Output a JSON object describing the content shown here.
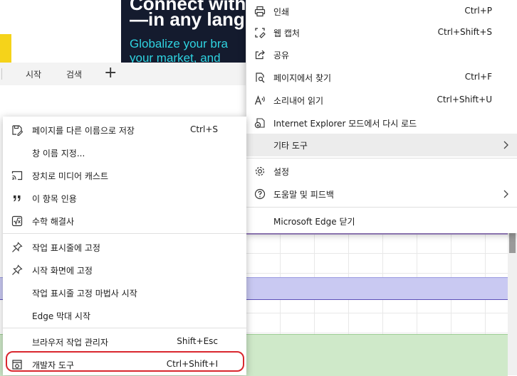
{
  "banner": {
    "line1": "Connect with",
    "line2": "—in any langu",
    "line3": "Globalize your bra",
    "line4": "your market, and"
  },
  "tabs": [
    {
      "label": "시작"
    },
    {
      "label": "검색"
    }
  ],
  "new_tab_glyph": "+",
  "main_menu": {
    "items": [
      {
        "label": "인쇄",
        "shortcut": "Ctrl+P",
        "icon": "print-icon"
      },
      {
        "label": "웹 캡처",
        "shortcut": "Ctrl+Shift+S",
        "icon": "web-capture-icon"
      },
      {
        "label": "공유",
        "shortcut": "",
        "icon": "share-icon"
      },
      {
        "label": "페이지에서 찾기",
        "shortcut": "Ctrl+F",
        "icon": "find-icon"
      },
      {
        "label": "소리내어 읽기",
        "shortcut": "Ctrl+Shift+U",
        "icon": "read-aloud-icon"
      },
      {
        "label": "Internet Explorer 모드에서 다시 로드",
        "shortcut": "",
        "icon": "ie-mode-icon"
      },
      {
        "label": "기타 도구",
        "shortcut": "",
        "icon": ""
      },
      {
        "label": "설정",
        "shortcut": "",
        "icon": "gear-icon"
      },
      {
        "label": "도움말 및 피드백",
        "shortcut": "",
        "icon": "help-icon"
      },
      {
        "label": "Microsoft Edge 닫기",
        "shortcut": "",
        "icon": ""
      }
    ]
  },
  "sub_menu": {
    "items": [
      {
        "label": "페이지를 다른 이름으로 저장",
        "shortcut": "Ctrl+S",
        "icon": "save-as-icon"
      },
      {
        "label": "창 이름 지정...",
        "shortcut": "",
        "icon": ""
      },
      {
        "label": "장치로 미디어 캐스트",
        "shortcut": "",
        "icon": "cast-icon"
      },
      {
        "label": "이 항목 인용",
        "shortcut": "",
        "icon": "quote-icon"
      },
      {
        "label": "수학 해결사",
        "shortcut": "",
        "icon": "math-solver-icon"
      },
      {
        "label": "작업 표시줄에 고정",
        "shortcut": "",
        "icon": "pin-icon"
      },
      {
        "label": "시작 화면에 고정",
        "shortcut": "",
        "icon": "pin-icon"
      },
      {
        "label": "작업 표시줄 고정 마법사 시작",
        "shortcut": "",
        "icon": ""
      },
      {
        "label": "Edge 막대 시작",
        "shortcut": "",
        "icon": ""
      },
      {
        "label": "브라우저 작업 관리자",
        "shortcut": "Shift+Esc",
        "icon": ""
      },
      {
        "label": "개발자 도구",
        "shortcut": "Ctrl+Shift+I",
        "icon": "dev-tools-icon"
      }
    ]
  },
  "colors": {
    "highlight_ring": "#d9272e",
    "hover_bg": "#ececec",
    "banner_bg": "#141b2e",
    "banner_accent": "#2fd3e0"
  }
}
